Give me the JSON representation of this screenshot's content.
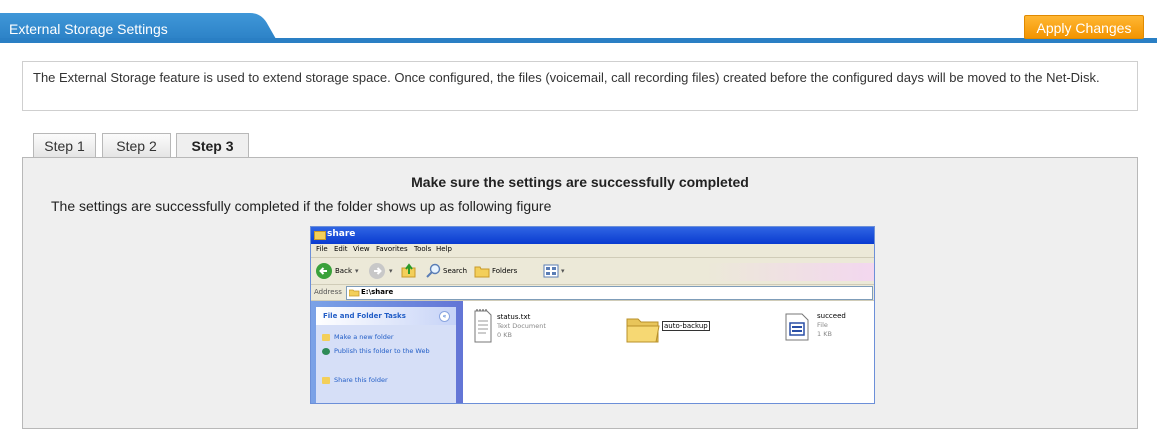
{
  "header": {
    "title": "External Storage Settings",
    "apply_button": "Apply Changes"
  },
  "description": "The External Storage feature is used to extend storage space. Once configured, the files (voicemail, call recording files) created before the configured days will be moved to the Net-Disk.",
  "tabs": [
    {
      "label": "Step 1",
      "active": false
    },
    {
      "label": "Step 2",
      "active": false
    },
    {
      "label": "Step 3",
      "active": true
    }
  ],
  "panel": {
    "title": "Make sure the settings are successfully completed",
    "instruction": "The settings are successfully completed if the folder shows up as following figure"
  },
  "figure": {
    "window_title": "share",
    "menu": [
      "File",
      "Edit",
      "View",
      "Favorites",
      "Tools",
      "Help"
    ],
    "toolbar": {
      "back": "Back",
      "search": "Search",
      "folders": "Folders"
    },
    "address_label": "Address",
    "address_value": "E:\\share",
    "side_panel": {
      "title": "File and Folder Tasks",
      "tasks": [
        "Make a new folder",
        "Publish this folder to the Web",
        "Share this folder"
      ]
    },
    "items": [
      {
        "name": "status.txt",
        "type": "Text Document",
        "size": "0 KB"
      },
      {
        "name": "auto-backup"
      },
      {
        "name": "succeed",
        "type": "File",
        "size": "1 KB"
      }
    ]
  },
  "colors": {
    "header_blue": "#2a7fc4",
    "apply_orange": "#f39400",
    "xp_title_blue": "#0a3bd0",
    "xp_taskpane": "#6375d6"
  }
}
